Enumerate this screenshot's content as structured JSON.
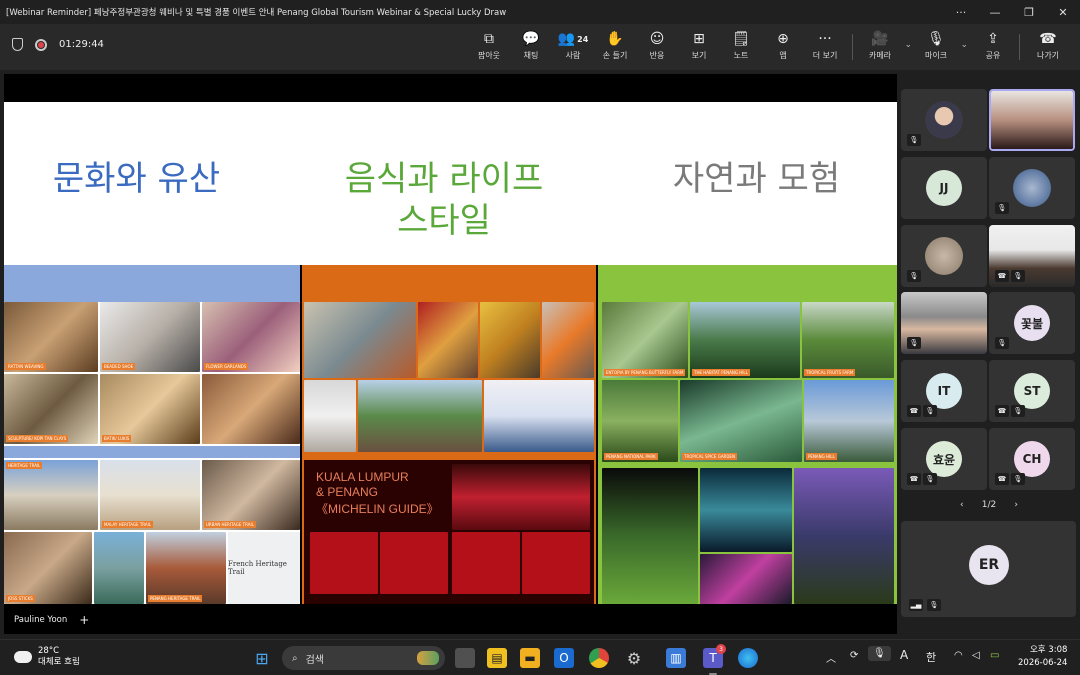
{
  "window": {
    "title": "[Webinar Reminder] 페낭주정부관광청 웨비나 및 특별 경품 이벤트 안내 Penang Global Tourism Webinar & Special Lucky Draw",
    "more": "···",
    "minimize": "—",
    "restore": "❐",
    "close": "✕"
  },
  "meeting": {
    "timer": "01:29:44",
    "toolbar": [
      {
        "id": "popout",
        "icon": "⧉",
        "label": "팝아웃"
      },
      {
        "id": "chat",
        "icon": "💬",
        "label": "채팅"
      },
      {
        "id": "people",
        "icon": "👥",
        "label": "사람",
        "count": "24"
      },
      {
        "id": "raise-hand",
        "icon": "✋",
        "label": "손 들기"
      },
      {
        "id": "react",
        "icon": "☺",
        "label": "반응"
      },
      {
        "id": "view",
        "icon": "⊞",
        "label": "보기"
      },
      {
        "id": "notes",
        "icon": "🗒",
        "label": "노트"
      },
      {
        "id": "apps",
        "icon": "⊕",
        "label": "앱"
      },
      {
        "id": "more",
        "icon": "···",
        "label": "더 보기"
      },
      {
        "id": "camera",
        "icon": "🎥",
        "label": "카메라"
      },
      {
        "id": "mic",
        "icon": "🎙",
        "label": "마이크"
      },
      {
        "id": "share",
        "icon": "⇪",
        "label": "공유"
      },
      {
        "id": "leave",
        "icon": "☎",
        "label": "나가기"
      }
    ],
    "presenter": "Pauline Yoon",
    "presenter_add": "+"
  },
  "slide": {
    "headings": [
      "문화와 유산",
      "음식과 라이프\n스타일",
      "자연과 모험"
    ],
    "colors": {
      "culture": "#3a6bc0",
      "food": "#5aa83a",
      "nature": "#7a7a7a",
      "blue_band": "#8aa8dc",
      "orange_band": "#db6a16",
      "green_band": "#8ac43f"
    },
    "culture_captions": [
      "RATTAN WEAVING",
      "BEADED SHOE",
      "BATIK/ LUKIS",
      "FLOWER GARLANDS",
      "SCULPTURE/ KOPI TAN CLAYS",
      "HERITAGE TRAIL",
      "PENANG HERITAGE TRAIL",
      "MALAY HERITAGE TRAIL",
      "URBAN HERITAGE TRAIL",
      "JOSS STICKS",
      "French Heritage Trail"
    ],
    "french_trail": "French Heritage Trail",
    "michelin": [
      "KUALA LUMPUR",
      "& PENANG",
      "《MICHELIN GUIDE》"
    ],
    "nature_captions": [
      "ENTOPIA BY PENANG BUTTERFLY FARM",
      "THE HABITAT PENANG HILL",
      "TROPICAL FRUITS FARM",
      "PENANG NATIONAL PARK",
      "TROPICAL SPICE GARDEN",
      "PENANG HILL"
    ]
  },
  "participants": {
    "tiles": [
      {
        "type": "photo",
        "initials": ""
      },
      {
        "type": "photo",
        "initials": ""
      },
      {
        "type": "initials",
        "initials": "JJ"
      },
      {
        "type": "photo",
        "initials": ""
      },
      {
        "type": "photo",
        "initials": ""
      },
      {
        "type": "photo",
        "initials": ""
      },
      {
        "type": "photo",
        "initials": ""
      },
      {
        "type": "initials",
        "initials": "꽃불"
      },
      {
        "type": "initials",
        "initials": "IT"
      },
      {
        "type": "initials",
        "initials": "ST"
      },
      {
        "type": "initials",
        "initials": "효윤"
      },
      {
        "type": "initials",
        "initials": "CH"
      }
    ],
    "page": "1/2",
    "prev": "‹",
    "next": "›",
    "large_tile": "ER"
  },
  "taskbar": {
    "weather_temp": "28°C",
    "weather_desc": "대체로 흐림",
    "search_placeholder": "검색",
    "notif_count": "3",
    "ime": "A",
    "lang": "한",
    "time": "오후 3:08",
    "date": "2026-06-24"
  }
}
